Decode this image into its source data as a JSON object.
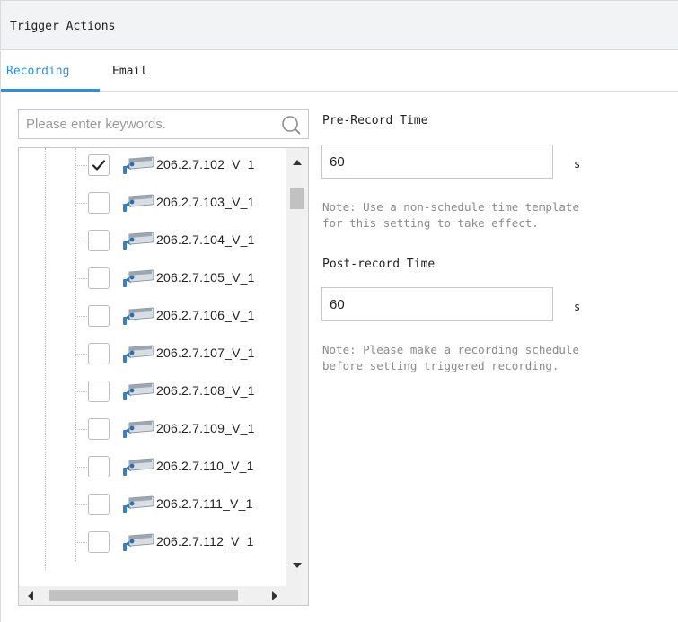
{
  "header": {
    "title": "Trigger Actions"
  },
  "tabs": [
    {
      "label": "Recording",
      "active": true
    },
    {
      "label": "Email",
      "active": false
    }
  ],
  "search": {
    "placeholder": "Please enter keywords.",
    "value": ""
  },
  "tree": {
    "items": [
      {
        "label": "206.2.7.102_V_1",
        "checked": true
      },
      {
        "label": "206.2.7.103_V_1",
        "checked": false
      },
      {
        "label": "206.2.7.104_V_1",
        "checked": false
      },
      {
        "label": "206.2.7.105_V_1",
        "checked": false
      },
      {
        "label": "206.2.7.106_V_1",
        "checked": false
      },
      {
        "label": "206.2.7.107_V_1",
        "checked": false
      },
      {
        "label": "206.2.7.108_V_1",
        "checked": false
      },
      {
        "label": "206.2.7.109_V_1",
        "checked": false
      },
      {
        "label": "206.2.7.110_V_1",
        "checked": false
      },
      {
        "label": "206.2.7.111_V_1",
        "checked": false
      },
      {
        "label": "206.2.7.112_V_1",
        "checked": false
      }
    ]
  },
  "pre_record": {
    "label": "Pre-Record Time",
    "value": "60",
    "unit": "s",
    "note_line1": "Note: Use a non-schedule time template",
    "note_line2": "for this setting to take effect."
  },
  "post_record": {
    "label": "Post-record Time",
    "value": "60",
    "unit": "s",
    "note_line1": "Note:  Please make a recording schedule",
    "note_line2": "before setting triggered recording."
  },
  "colors": {
    "accent": "#2f8fd8",
    "header_bg": "#f2f3f5",
    "border": "#d9d9d9",
    "note_text": "#8a8a8a"
  },
  "icons": {
    "search": "search-icon",
    "camera": "camera-icon",
    "check": "checkmark-icon"
  }
}
